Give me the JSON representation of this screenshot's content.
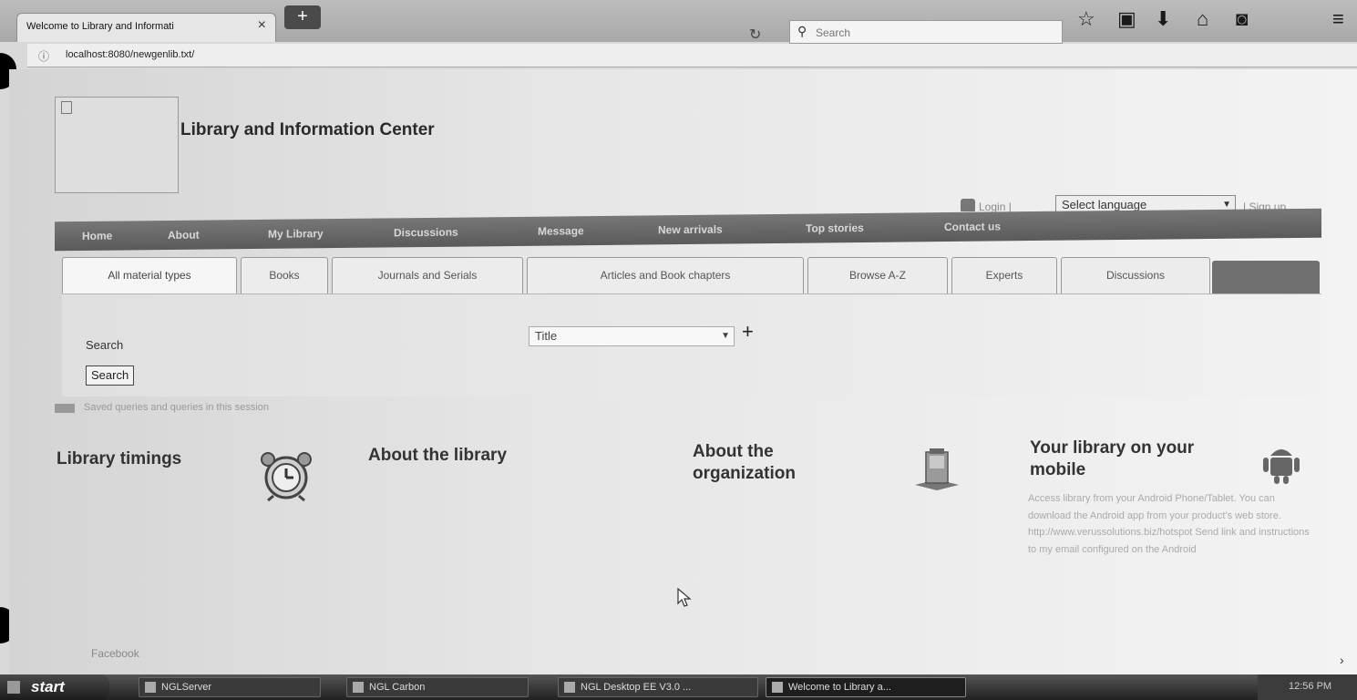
{
  "browser": {
    "tab_title": "Welcome to Library and Informati",
    "tab_close": "×",
    "new_tab": "+",
    "url": "localhost:8080/newgenlib.txt/",
    "search_placeholder": "Search"
  },
  "site": {
    "title": "Library and Information Center",
    "login": "Login |",
    "language_select": "Select language",
    "signup": "| Sign up"
  },
  "nav": {
    "items": [
      "Home",
      "About",
      "My Library",
      "Discussions",
      "Message",
      "New arrivals",
      "Top stories",
      "Contact us"
    ]
  },
  "material_tabs": {
    "items": [
      "All material types",
      "Books",
      "Journals and Serials",
      "Articles and Book chapters",
      "Browse A-Z",
      "Experts",
      "Discussions"
    ],
    "active": "All material types"
  },
  "search": {
    "label": "Search",
    "field": "Title",
    "add": "+",
    "button": "Search"
  },
  "saved_queries": "Saved queries and queries in this session",
  "columns": {
    "timings": "Library timings",
    "about_library": "About the library",
    "about_org": "About the organization",
    "mobile": "Your library on your mobile",
    "mobile_text": "Access library from your Android Phone/Tablet. You can download the Android app from your product's web store. http://www.verussolutions.biz/hotspot Send link and instructions to my email configured on the Android"
  },
  "footer": {
    "facebook": "Facebook"
  },
  "taskbar": {
    "start": "start",
    "items": [
      "NGLServer",
      "NGL Carbon",
      "NGL Desktop EE V3.0 ...",
      "Welcome to Library a..."
    ],
    "clock": "12:56 PM"
  }
}
